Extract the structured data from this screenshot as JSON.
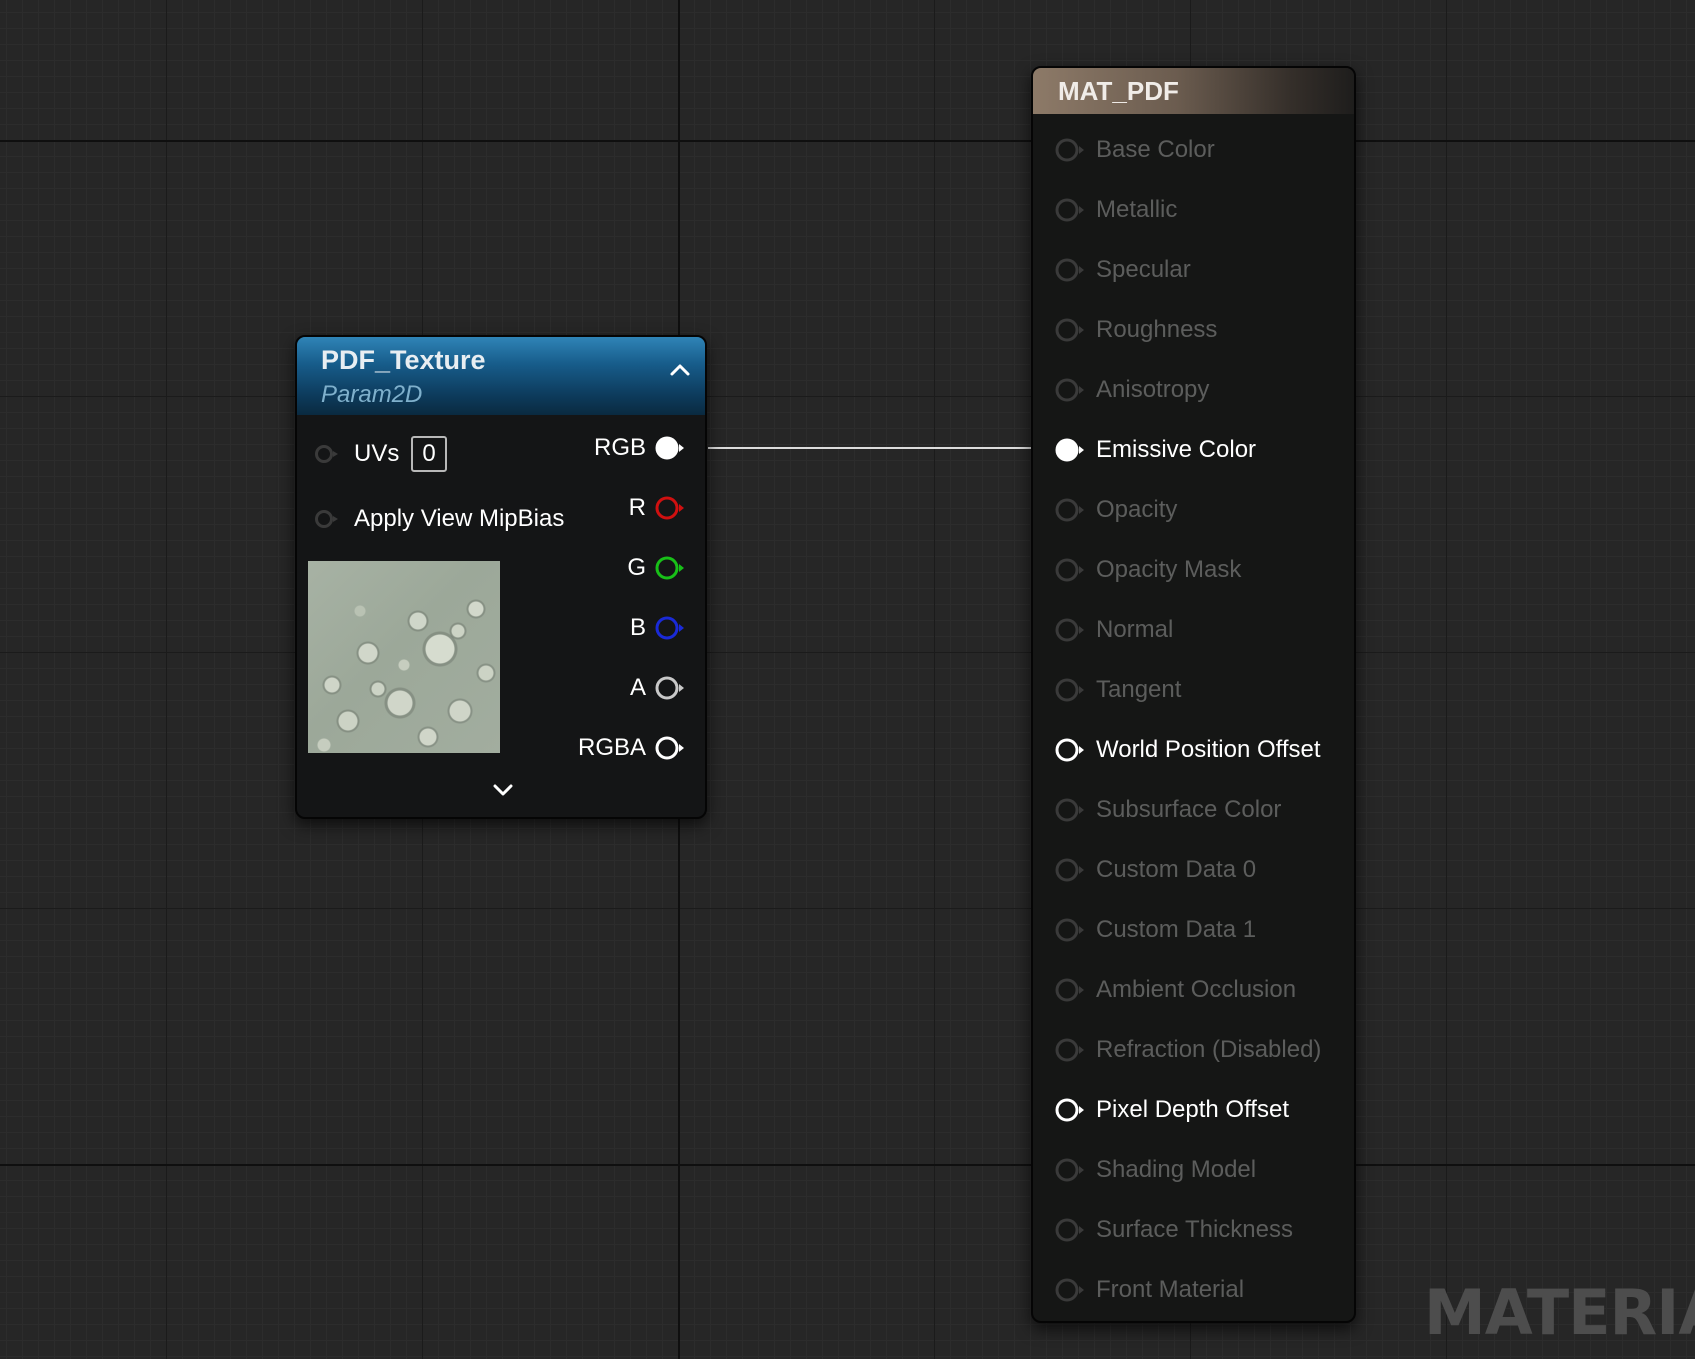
{
  "texture_node": {
    "title": "PDF_Texture",
    "subtitle": "Param2D",
    "inputs": {
      "uvs": {
        "label": "UVs",
        "value": "0"
      },
      "mipbias": {
        "label": "Apply View MipBias"
      }
    },
    "outputs": {
      "rgb": {
        "label": "RGB",
        "color": "#ffffff",
        "connected": true
      },
      "r": {
        "label": "R",
        "color": "#d01010"
      },
      "g": {
        "label": "G",
        "color": "#18c018"
      },
      "b": {
        "label": "B",
        "color": "#1a2ad8"
      },
      "a": {
        "label": "A",
        "color": "#c8c8c8"
      },
      "rgba": {
        "label": "RGBA",
        "color": "#ffffff"
      }
    }
  },
  "material_node": {
    "title": "MAT_PDF",
    "pins": [
      {
        "label": "Base Color",
        "state": "disabled"
      },
      {
        "label": "Metallic",
        "state": "disabled"
      },
      {
        "label": "Specular",
        "state": "disabled"
      },
      {
        "label": "Roughness",
        "state": "disabled"
      },
      {
        "label": "Anisotropy",
        "state": "disabled"
      },
      {
        "label": "Emissive Color",
        "state": "connected"
      },
      {
        "label": "Opacity",
        "state": "disabled"
      },
      {
        "label": "Opacity Mask",
        "state": "disabled"
      },
      {
        "label": "Normal",
        "state": "disabled"
      },
      {
        "label": "Tangent",
        "state": "disabled"
      },
      {
        "label": "World Position Offset",
        "state": "enabled"
      },
      {
        "label": "Subsurface Color",
        "state": "disabled"
      },
      {
        "label": "Custom Data 0",
        "state": "disabled"
      },
      {
        "label": "Custom Data 1",
        "state": "disabled"
      },
      {
        "label": "Ambient Occlusion",
        "state": "disabled"
      },
      {
        "label": "Refraction (Disabled)",
        "state": "disabled"
      },
      {
        "label": "Pixel Depth Offset",
        "state": "enabled"
      },
      {
        "label": "Shading Model",
        "state": "disabled"
      },
      {
        "label": "Surface Thickness",
        "state": "disabled"
      },
      {
        "label": "Front Material",
        "state": "disabled"
      }
    ]
  },
  "watermark": "MATERIAL",
  "colors": {
    "graph_bg": "#262626",
    "texture_header": "#175c8a",
    "material_header": "#8d7a68",
    "wire": "#dcdcdc"
  }
}
